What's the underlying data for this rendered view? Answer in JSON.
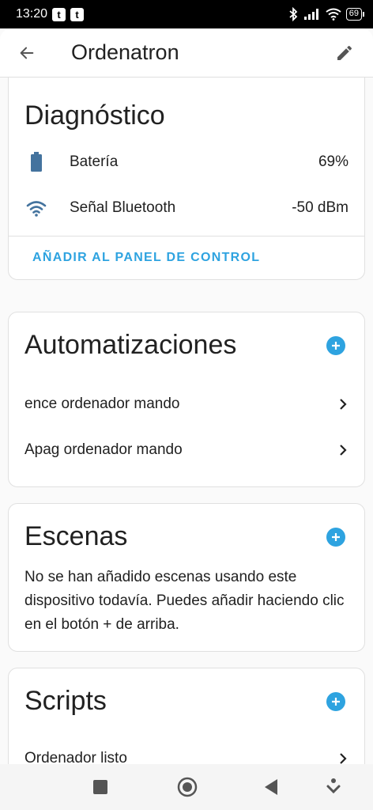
{
  "status_bar": {
    "time": "13:20",
    "notif_icons": [
      "t",
      "t"
    ],
    "battery": "69"
  },
  "app_bar": {
    "title": "Ordenatron"
  },
  "diagnostics": {
    "title": "Diagnóstico",
    "rows": [
      {
        "icon": "battery-icon",
        "label": "Batería",
        "value": "69%"
      },
      {
        "icon": "wifi-signal-icon",
        "label": "Señal Bluetooth",
        "value": "-50 dBm"
      }
    ],
    "action": "AÑADIR AL PANEL DE CONTROL"
  },
  "automations": {
    "title": "Automatizaciones",
    "items": [
      "ence ordenador mando",
      "Apag ordenador mando"
    ]
  },
  "scenes": {
    "title": "Escenas",
    "empty_text": "No se han añadido escenas usando este dispositivo todavía. Puedes añadir haciendo clic en el botón + de arriba."
  },
  "scripts": {
    "title": "Scripts",
    "items": [
      "Ordenador listo"
    ]
  },
  "colors": {
    "accent": "#2ea3e0",
    "icon_blue": "#44739e",
    "text": "#212121"
  }
}
